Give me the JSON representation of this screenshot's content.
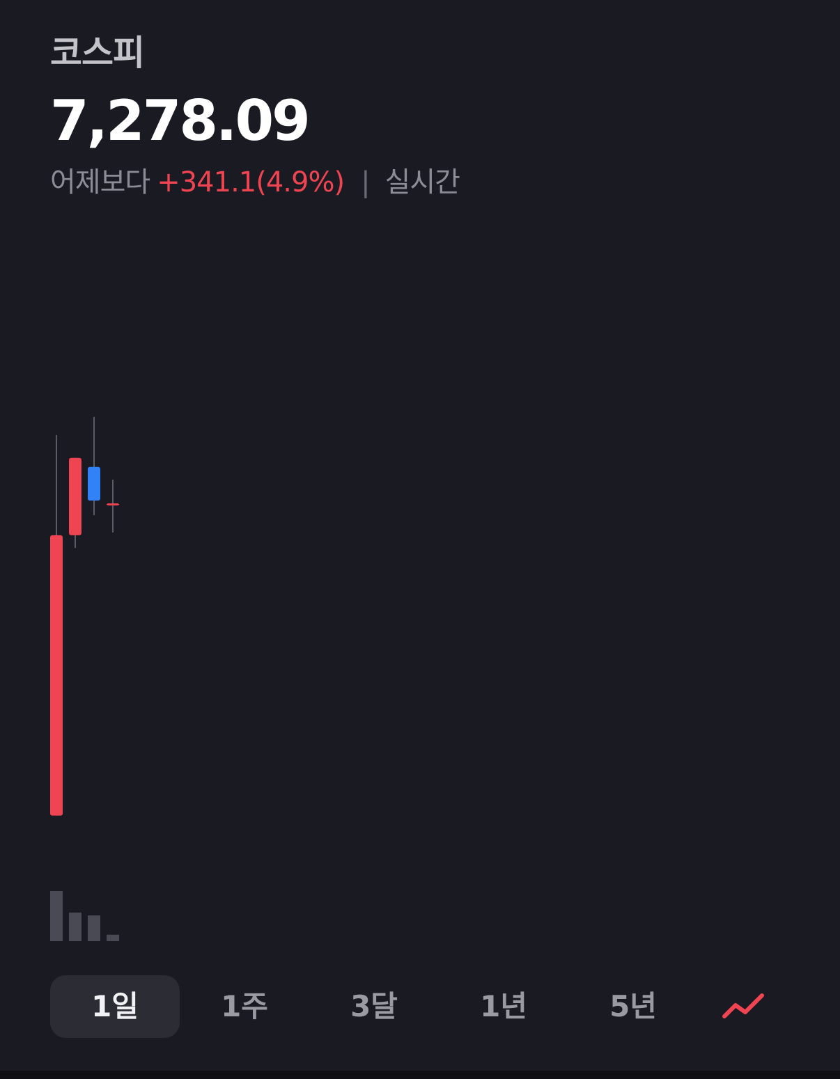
{
  "header": {
    "title": "코스피",
    "price": "7,278.09",
    "change_prefix": "어제보다",
    "change_value": "+341.1(4.9%)",
    "separator": "|",
    "realtime_label": "실시간"
  },
  "colors": {
    "background": "#1a1a22",
    "up": "#ef4452",
    "down": "#3182f6",
    "wick": "#5a5a64",
    "volume": "#4a4a55",
    "tab_active_bg": "#2c2c35"
  },
  "tabs": [
    {
      "label": "1일",
      "active": true
    },
    {
      "label": "1주",
      "active": false
    },
    {
      "label": "3달",
      "active": false
    },
    {
      "label": "1년",
      "active": false
    },
    {
      "label": "5년",
      "active": false
    }
  ],
  "chart_toggle": {
    "icon": "line-chart-icon"
  },
  "chart_data": {
    "type": "candlestick",
    "ylim": [
      6900,
      7420
    ],
    "candles": [
      {
        "open": 6937.0,
        "close": 7245.0,
        "high": 7355.0,
        "low": 6937.0,
        "direction": "up"
      },
      {
        "open": 7245.0,
        "close": 7330.0,
        "high": 7330.0,
        "low": 7231.0,
        "direction": "up"
      },
      {
        "open": 7320.0,
        "close": 7283.0,
        "high": 7375.0,
        "low": 7267.0,
        "direction": "down"
      },
      {
        "open": 7278.0,
        "close": 7280.0,
        "high": 7306.0,
        "low": 7248.0,
        "direction": "up"
      }
    ],
    "volume": {
      "values": [
        70,
        40,
        36,
        9
      ],
      "ylim": [
        0,
        70
      ]
    }
  }
}
